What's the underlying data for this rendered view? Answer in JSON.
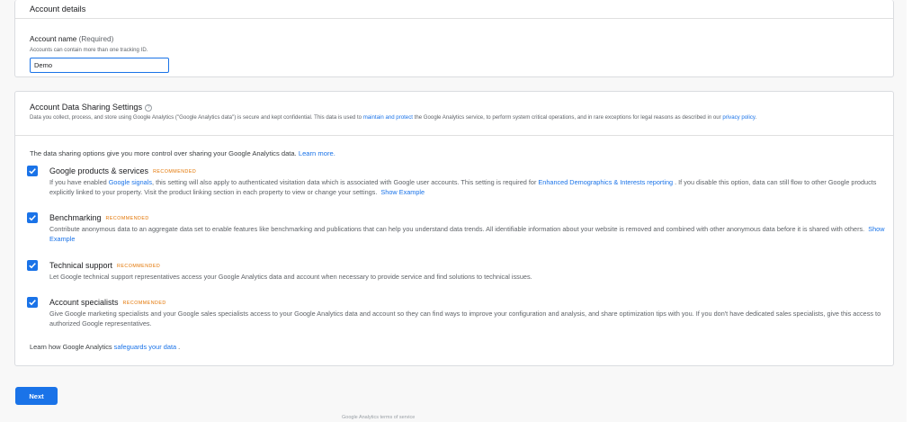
{
  "account_details": {
    "title": "Account details",
    "name_label": "Account name",
    "name_required": "(Required)",
    "name_hint": "Accounts can contain more than one tracking ID.",
    "name_value": "Demo"
  },
  "sharing": {
    "title": "Account Data Sharing Settings",
    "help_glyph": "?",
    "intro_part1": "Data you collect, process, and store using Google Analytics (\"Google Analytics data\") is secure and kept confidential. This data is used to ",
    "intro_link1": "maintain and protect",
    "intro_part2": " the Google Analytics service, to perform system critical operations, and in rare exceptions for legal reasons as described in our ",
    "intro_link2": "privacy policy",
    "intro_part3": ".",
    "lead_text": "The data sharing options give you more control over sharing your Google Analytics data. ",
    "lead_link": "Learn more.",
    "recommended_label": "RECOMMENDED",
    "options": [
      {
        "title": "Google products & services",
        "desc_part1": "If you have enabled ",
        "desc_link1": "Google signals",
        "desc_part2": ", this setting will also apply to authenticated visitation data which is associated with Google user accounts. This setting is required for ",
        "desc_link2": "Enhanced Demographics & Interests reporting",
        "desc_part3": " . If you disable this option, data can still flow to other Google products explicitly linked to your property. Visit the product linking section in each property to view or change your settings.",
        "example": "Show Example",
        "checked": true
      },
      {
        "title": "Benchmarking",
        "desc": "Contribute anonymous data to an aggregate data set to enable features like benchmarking and publications that can help you understand data trends. All identifiable information about your website is removed and combined with other anonymous data before it is shared with others.",
        "example": "Show Example",
        "checked": true
      },
      {
        "title": "Technical support",
        "desc": "Let Google technical support representatives access your Google Analytics data and account when necessary to provide service and find solutions to technical issues.",
        "checked": true
      },
      {
        "title": "Account specialists",
        "desc": "Give Google marketing specialists and your Google sales specialists access to your Google Analytics data and account so they can find ways to improve your configuration and analysis, and share optimization tips with you. If you don't have dedicated sales specialists, give this access to authorized Google representatives.",
        "checked": true
      }
    ],
    "learn_text": "Learn how Google Analytics ",
    "learn_link": "safeguards your data",
    "learn_end": " ."
  },
  "actions": {
    "next_label": "Next"
  },
  "footer": {
    "text": "Google Analytics terms of service"
  },
  "colors": {
    "primary": "#1a73e8",
    "recommended": "#e37400"
  }
}
